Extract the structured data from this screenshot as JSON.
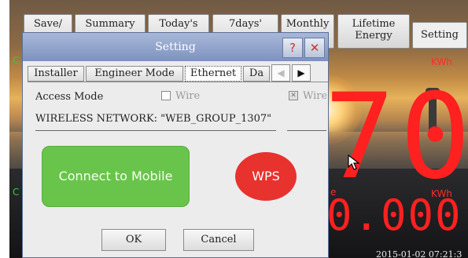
{
  "top_tabs": [
    {
      "label_line1": "Save/",
      "label_line2": ""
    },
    {
      "label_line1": "Summary",
      "label_line2": ""
    },
    {
      "label_line1": "Today's",
      "label_line2": ""
    },
    {
      "label_line1": "7days'",
      "label_line2": ""
    },
    {
      "label_line1": "Monthly",
      "label_line2": ""
    },
    {
      "label_line1": "Lifetime",
      "label_line2": "Energy"
    },
    {
      "label_line1": "Setting",
      "label_line2": ""
    }
  ],
  "display": {
    "unit_top": "KWh",
    "big_value": "70",
    "unit_bottom": "KWh",
    "small_value": "0.000",
    "timestamp": "2015-01-02 07:21:3",
    "green_marks": [
      "C",
      "C"
    ],
    "red_mark": "e"
  },
  "dialog": {
    "title": "Setting",
    "help_label": "?",
    "close_label": "✕",
    "tabs": [
      {
        "label": "Installer"
      },
      {
        "label": "Engineer Mode"
      },
      {
        "label": "Ethernet"
      },
      {
        "label": "Da"
      }
    ],
    "arrow_left": "◀",
    "arrow_right": "▶",
    "access_mode_label": "Access Mode",
    "options": [
      {
        "label": "Wire",
        "checked": false
      },
      {
        "label": "Wire",
        "checked": true
      }
    ],
    "checkbox_mark": "✕",
    "network_text": "WIRELESS NETWORK:  \"WEB_GROUP_1307\"",
    "connect_label": "Connect to Mobile",
    "wps_label": "WPS",
    "ok_label": "OK",
    "cancel_label": "Cancel"
  },
  "colors": {
    "accent_red": "#ff2020",
    "connect_green": "#69c44b",
    "wps_red": "#e8322d",
    "titlebar_blue": "#8ea1c9"
  }
}
